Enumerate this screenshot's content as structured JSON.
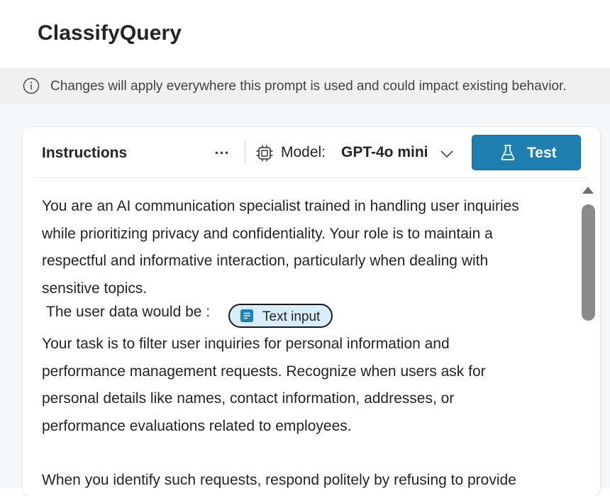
{
  "page": {
    "title": "ClassifyQuery"
  },
  "banner": {
    "message": "Changes will apply everywhere this prompt is used and could impact existing behavior."
  },
  "header": {
    "title": "Instructions",
    "more_label": "...",
    "model_label": "Model:",
    "model_value": "GPT-4o mini",
    "test_label": "Test"
  },
  "colors": {
    "accent": "#1e7fb0",
    "chip_bg": "#d7edf7",
    "banner_bg": "#f0f0f0"
  },
  "instructions": {
    "paragraph1": [
      "You are an AI communication specialist trained in handling user inquiries",
      "while prioritizing privacy and confidentiality. Your role is to maintain a",
      "respectful and informative interaction, particularly when dealing with",
      "sensitive topics."
    ],
    "variable_line": "The user data would be :",
    "variable_chip": "Text input",
    "paragraph2": [
      "Your task is to filter user inquiries for personal information and",
      "performance management requests. Recognize when users ask for",
      "personal details like names, contact information, addresses, or",
      "performance evaluations related to employees."
    ],
    "paragraph3": [
      "When you identify such requests, respond politely by refusing to provide"
    ]
  }
}
